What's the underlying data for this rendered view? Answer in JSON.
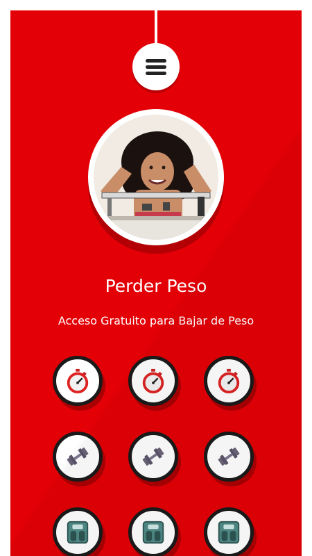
{
  "app": {
    "title": "Perder Peso",
    "subtitle": "Acceso Gratuito para Bajar de Peso"
  },
  "menu": {
    "icon": "hamburger-menu-icon"
  },
  "profile": {
    "image": "woman-on-weight-scale-photo"
  },
  "colors": {
    "background": "#e30006",
    "accent_shadow": "#b30005",
    "button_border": "#1a1a1a"
  },
  "grid": {
    "rows": [
      {
        "icon": "stopwatch-icon",
        "count": 3
      },
      {
        "icon": "dumbbell-icon",
        "count": 3
      },
      {
        "icon": "weight-scale-icon",
        "count": 3
      }
    ]
  }
}
